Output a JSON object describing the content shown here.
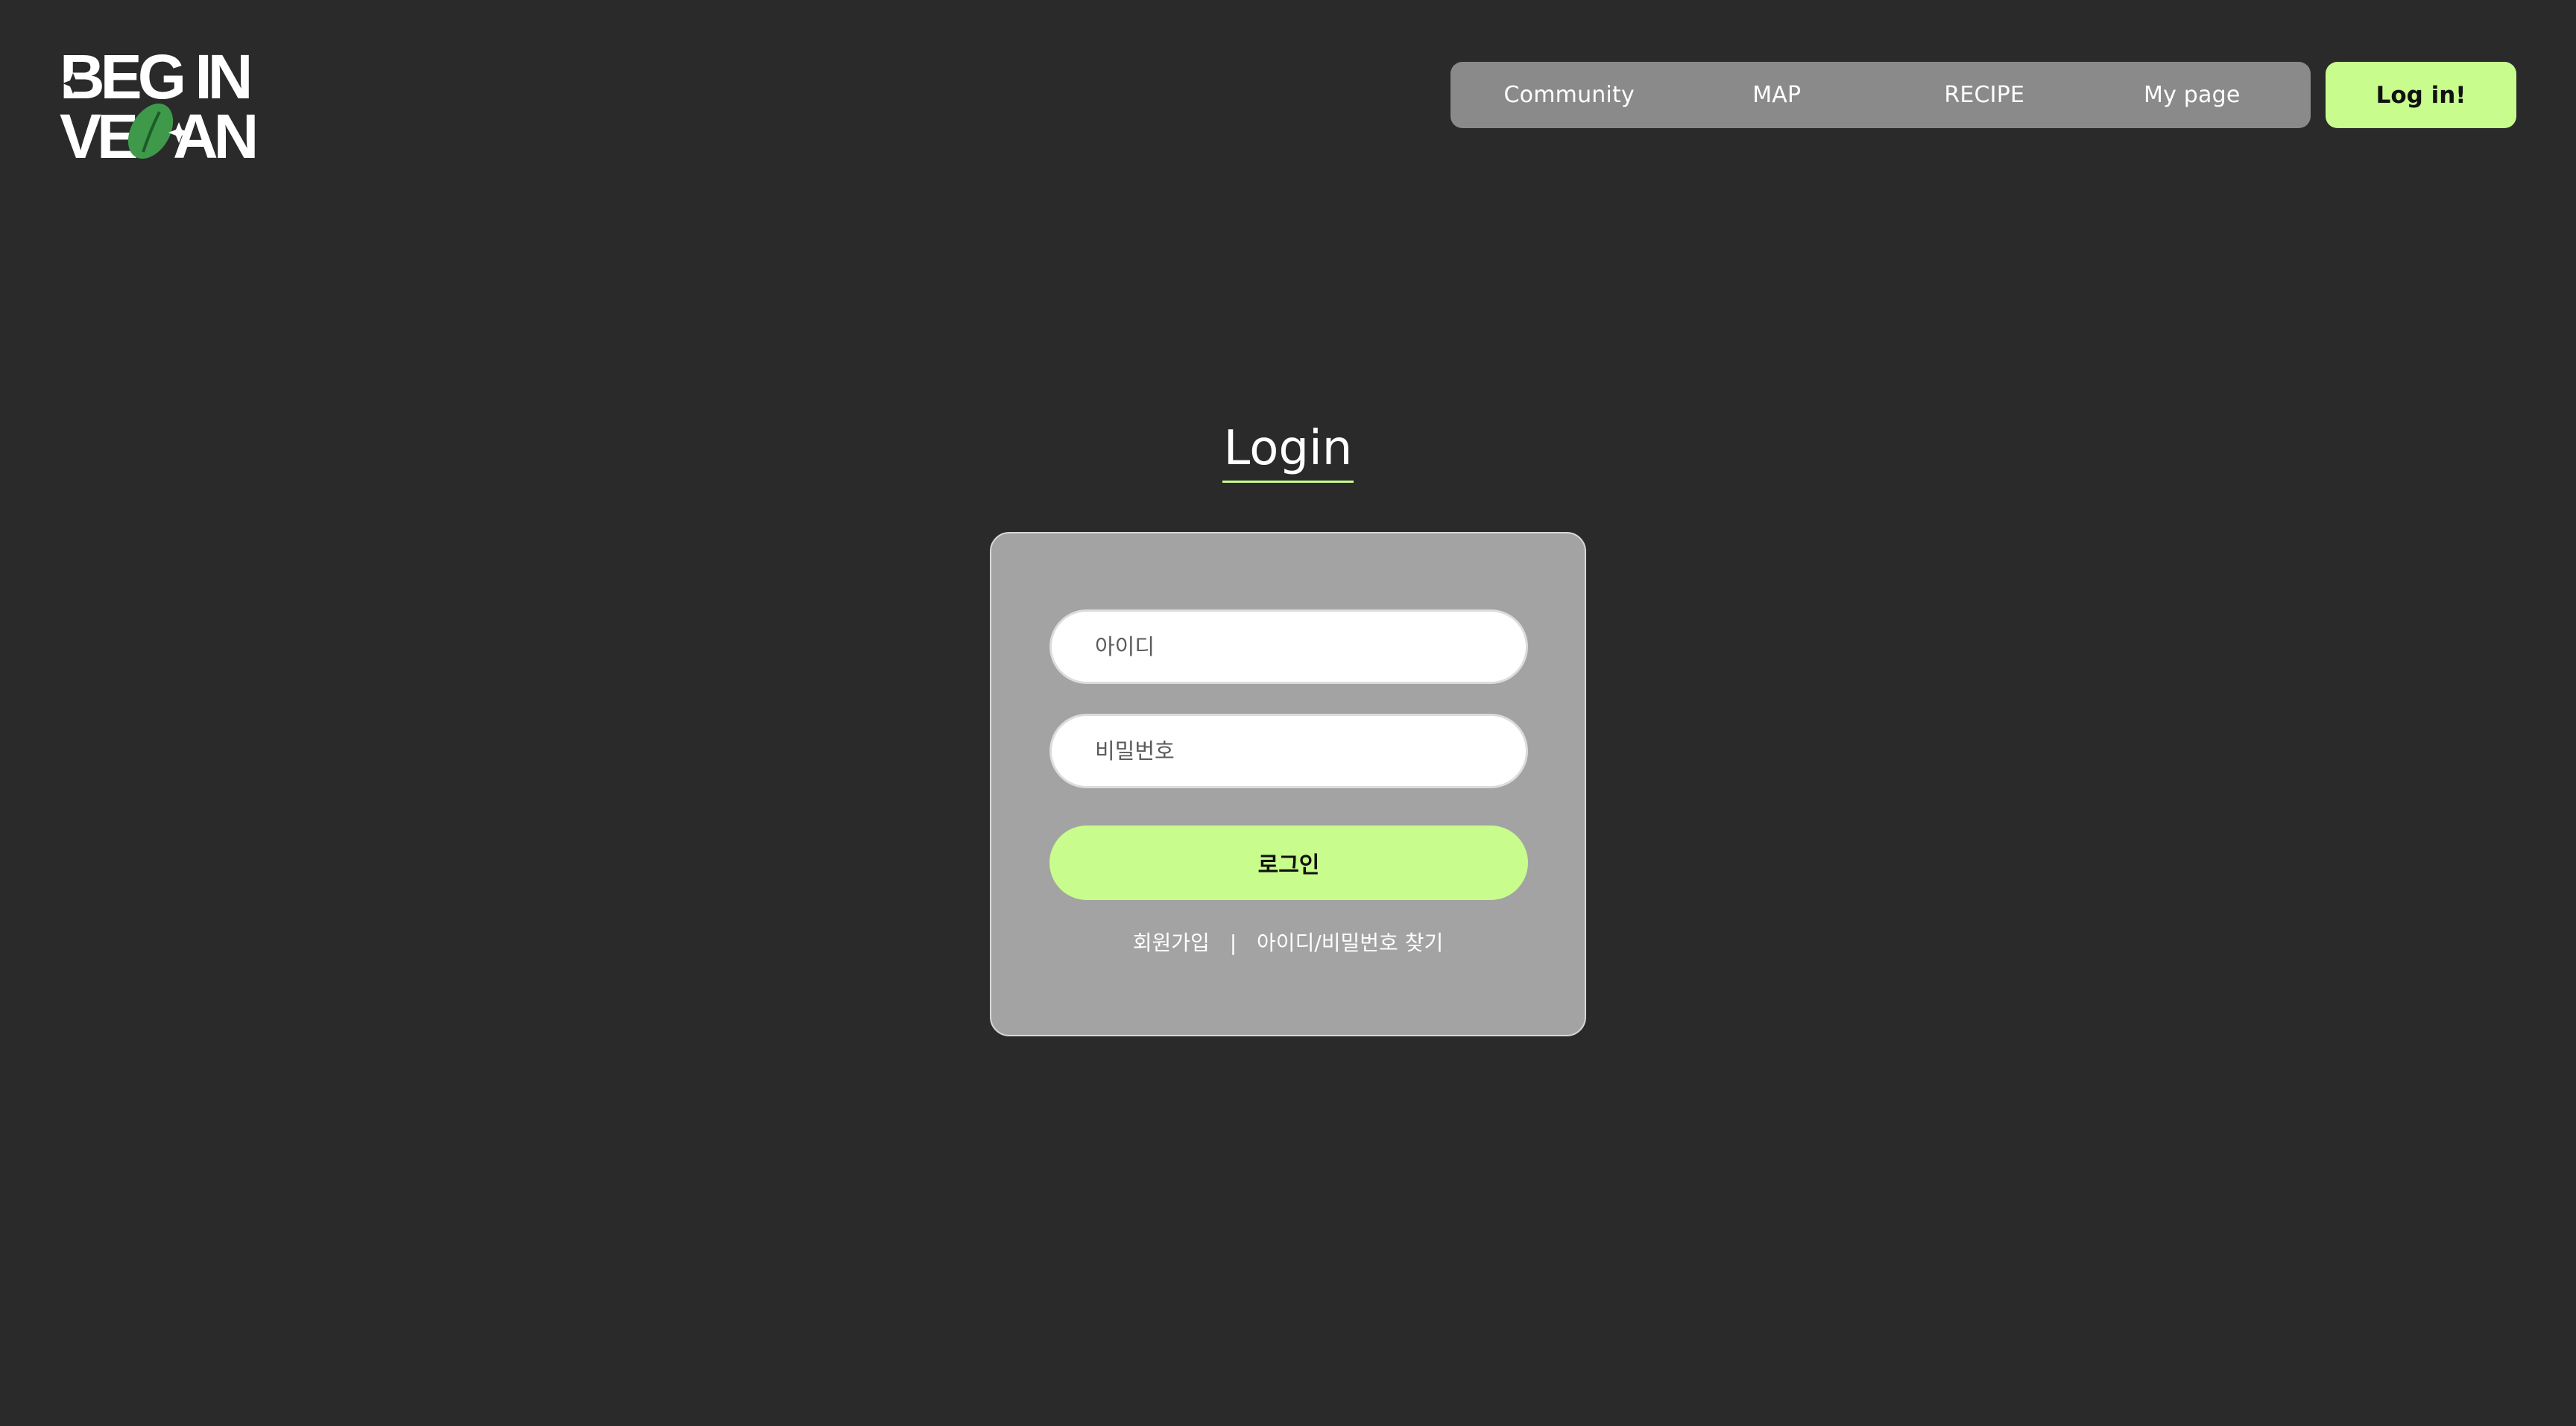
{
  "brand": {
    "logo_alt": "BEGIN VEGAN",
    "logo_line1": "BEG IN",
    "logo_line2": "VEGAN",
    "accent_color": "#c8fc8c",
    "leaf_color": "#3e9a4a"
  },
  "nav": {
    "items": [
      {
        "label": "Community"
      },
      {
        "label": "MAP"
      },
      {
        "label": "RECIPE"
      },
      {
        "label": "My page"
      }
    ],
    "login_label": "Log in!"
  },
  "main": {
    "title": "Login",
    "form": {
      "id_placeholder": "아이디",
      "pw_placeholder": "비밀번호",
      "submit_label": "로그인"
    },
    "links": {
      "signup": "회원가입",
      "separator": "|",
      "find": "아이디/비밀번호 찾기"
    }
  }
}
